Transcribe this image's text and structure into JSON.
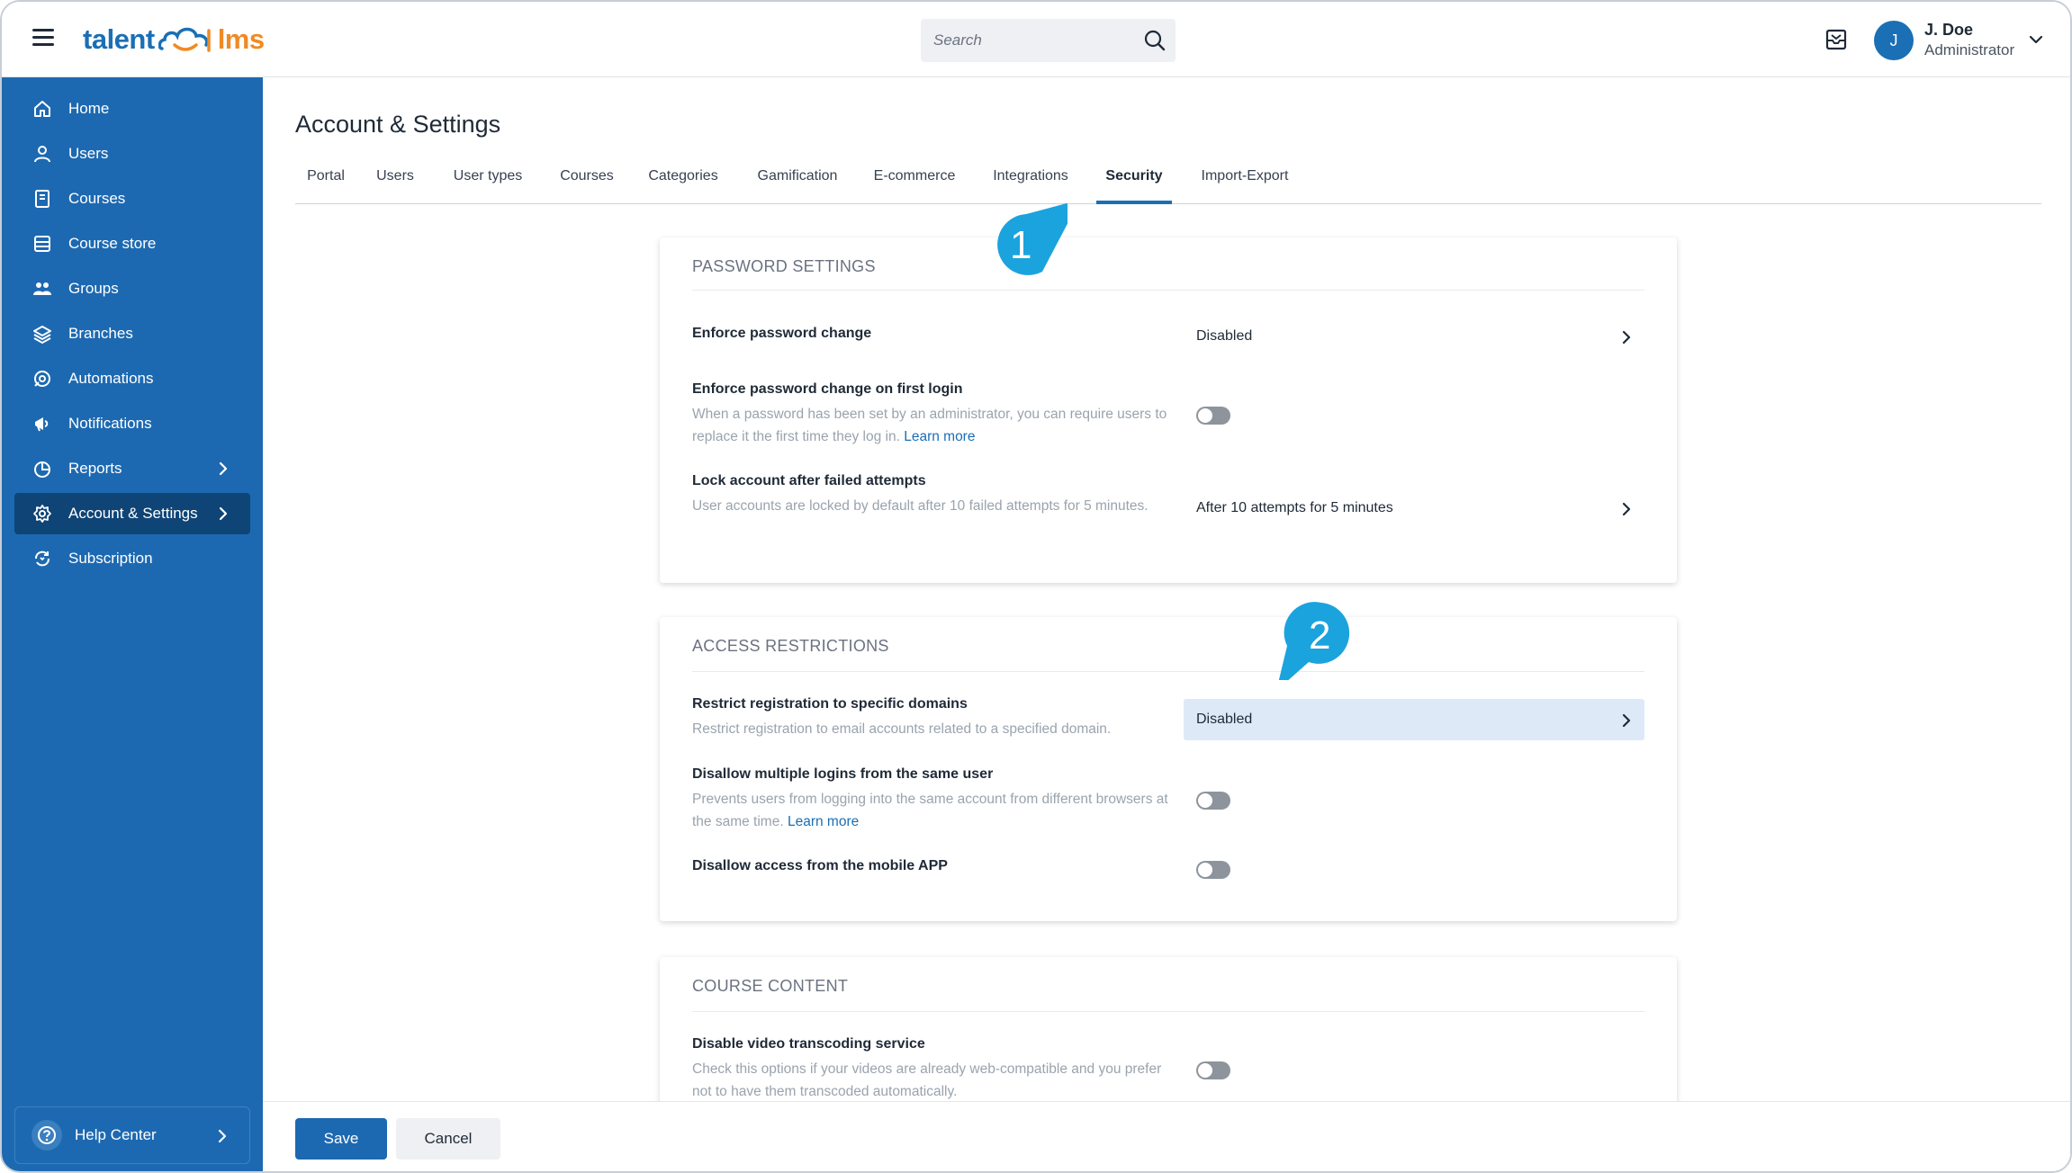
{
  "header": {
    "logo_left": "talent",
    "logo_right": "lms",
    "search_placeholder": "Search",
    "user_initial": "J",
    "user_name": "J. Doe",
    "user_role": "Administrator"
  },
  "sidebar": {
    "items": [
      {
        "label": "Home",
        "icon": "home-icon"
      },
      {
        "label": "Users",
        "icon": "user-icon"
      },
      {
        "label": "Courses",
        "icon": "book-icon"
      },
      {
        "label": "Course store",
        "icon": "store-icon"
      },
      {
        "label": "Groups",
        "icon": "groups-icon"
      },
      {
        "label": "Branches",
        "icon": "layers-icon"
      },
      {
        "label": "Automations",
        "icon": "automation-icon"
      },
      {
        "label": "Notifications",
        "icon": "megaphone-icon"
      },
      {
        "label": "Reports",
        "icon": "pie-chart-icon"
      },
      {
        "label": "Account & Settings",
        "icon": "gear-icon"
      },
      {
        "label": "Subscription",
        "icon": "subscription-icon"
      }
    ],
    "help_label": "Help Center"
  },
  "main": {
    "title": "Account & Settings",
    "tabs": [
      "Portal",
      "Users",
      "User types",
      "Courses",
      "Categories",
      "Gamification",
      "E-commerce",
      "Integrations",
      "Security",
      "Import-Export"
    ],
    "active_tab": "Security"
  },
  "sections": {
    "password": {
      "title": "PASSWORD SETTINGS",
      "enforce_change_label": "Enforce password change",
      "enforce_change_value": "Disabled",
      "first_login_label": "Enforce password change on first login",
      "first_login_desc": "When a password has been set by an administrator, you can require users to replace it the first time they log in.",
      "learn_more": "Learn more",
      "lock_label": "Lock account after failed attempts",
      "lock_desc": "User accounts are locked by default after 10 failed attempts for 5 minutes.",
      "lock_value": "After 10 attempts for 5 minutes"
    },
    "access": {
      "title": "ACCESS RESTRICTIONS",
      "restrict_label": "Restrict registration to specific domains",
      "restrict_desc": "Restrict registration to email accounts related to a specified domain.",
      "restrict_value": "Disabled",
      "multi_login_label": "Disallow multiple logins from the same user",
      "multi_login_desc": "Prevents users from logging into the same account from different browsers at the same time.",
      "learn_more": "Learn more",
      "mobile_label": "Disallow access from the mobile APP"
    },
    "course": {
      "title": "COURSE CONTENT",
      "video_label": "Disable video transcoding service",
      "video_desc": "Check this options if your videos are already web-compatible and you prefer not to have them transcoded automatically."
    }
  },
  "annotations": [
    "1",
    "2"
  ],
  "footer": {
    "save": "Save",
    "cancel": "Cancel"
  },
  "colors": {
    "brand_blue": "#1d69b1",
    "active_nav": "#0f4476",
    "bubble": "#1ba3de",
    "logo_orange": "#f08a24"
  }
}
